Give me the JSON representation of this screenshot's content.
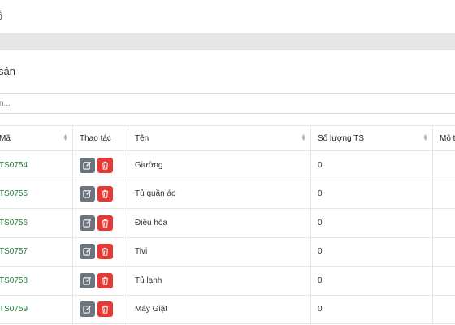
{
  "header": {
    "title_fragment": "ỗ"
  },
  "section": {
    "title": "sản"
  },
  "search": {
    "placeholder": "n..."
  },
  "colors": {
    "code_text": "#1e7e34",
    "edit_button": "#6c757d",
    "delete_button": "#e53935"
  },
  "table": {
    "columns": [
      {
        "label": "Mã",
        "sortable": true
      },
      {
        "label": "Thao tác",
        "sortable": false
      },
      {
        "label": "Tên",
        "sortable": true
      },
      {
        "label": "Số lượng TS",
        "sortable": true
      },
      {
        "label": "Mô t",
        "sortable": false
      }
    ],
    "rows": [
      {
        "code": "TS0754",
        "name": "Giường",
        "quantity": "0",
        "description": ""
      },
      {
        "code": "TS0755",
        "name": "Tủ quần áo",
        "quantity": "0",
        "description": ""
      },
      {
        "code": "TS0756",
        "name": "Điều hòa",
        "quantity": "0",
        "description": ""
      },
      {
        "code": "TS0757",
        "name": "Tivi",
        "quantity": "0",
        "description": ""
      },
      {
        "code": "TS0758",
        "name": "Tủ lạnh",
        "quantity": "0",
        "description": ""
      },
      {
        "code": "TS0759",
        "name": "Máy Giặt",
        "quantity": "0",
        "description": ""
      }
    ],
    "row_actions": [
      {
        "icon": "edit-icon"
      },
      {
        "icon": "trash-icon"
      }
    ]
  }
}
